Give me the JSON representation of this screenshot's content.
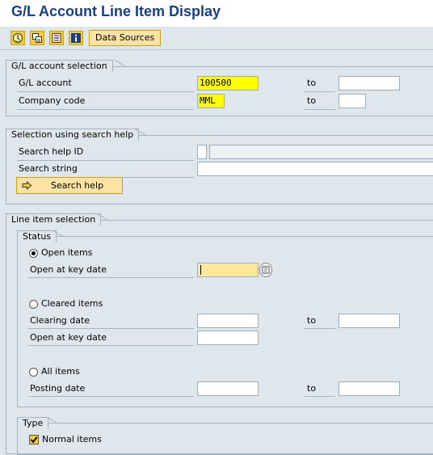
{
  "window": {
    "title": "G/L Account Line Item Display"
  },
  "toolbar": {
    "icons": [
      "execute-icon",
      "get-variant-icon",
      "dynamic-selections-icon",
      "program-documentation-icon"
    ],
    "data_sources_label": "Data Sources"
  },
  "gl_selection": {
    "title": "G/L account selection",
    "gl_account_label": "G/L account",
    "gl_account_value": "100500",
    "gl_account_to_label": "to",
    "gl_account_to_value": "",
    "company_code_label": "Company code",
    "company_code_value": "MML",
    "company_code_to_label": "to",
    "company_code_to_value": ""
  },
  "search_help": {
    "title": "Selection using search help",
    "search_help_id_label": "Search help ID",
    "search_help_id_value": "",
    "search_string_label": "Search string",
    "search_string_value": "",
    "button_label": "Search help"
  },
  "line_item_selection": {
    "title": "Line item selection",
    "status": {
      "title": "Status",
      "open_items": {
        "label": "Open items",
        "selected": true,
        "key_date_label": "Open at key date",
        "key_date_value": ""
      },
      "cleared_items": {
        "label": "Cleared items",
        "selected": false,
        "clearing_date_label": "Clearing date",
        "clearing_date_from": "",
        "clearing_date_to_label": "to",
        "clearing_date_to": "",
        "key_date_label": "Open at key date",
        "key_date_value": ""
      },
      "all_items": {
        "label": "All items",
        "selected": false,
        "posting_date_label": "Posting date",
        "posting_date_from": "",
        "posting_date_to_label": "to",
        "posting_date_to": ""
      }
    },
    "type": {
      "title": "Type",
      "normal_items_label": "Normal items",
      "normal_items_checked": true
    }
  },
  "colors": {
    "title_blue": "#1a3f84",
    "background": "#dfe6ec",
    "highlight_yellow": "#ffff00",
    "focus_field": "#ffe89a",
    "button_yellow": "#f2cb3a"
  }
}
